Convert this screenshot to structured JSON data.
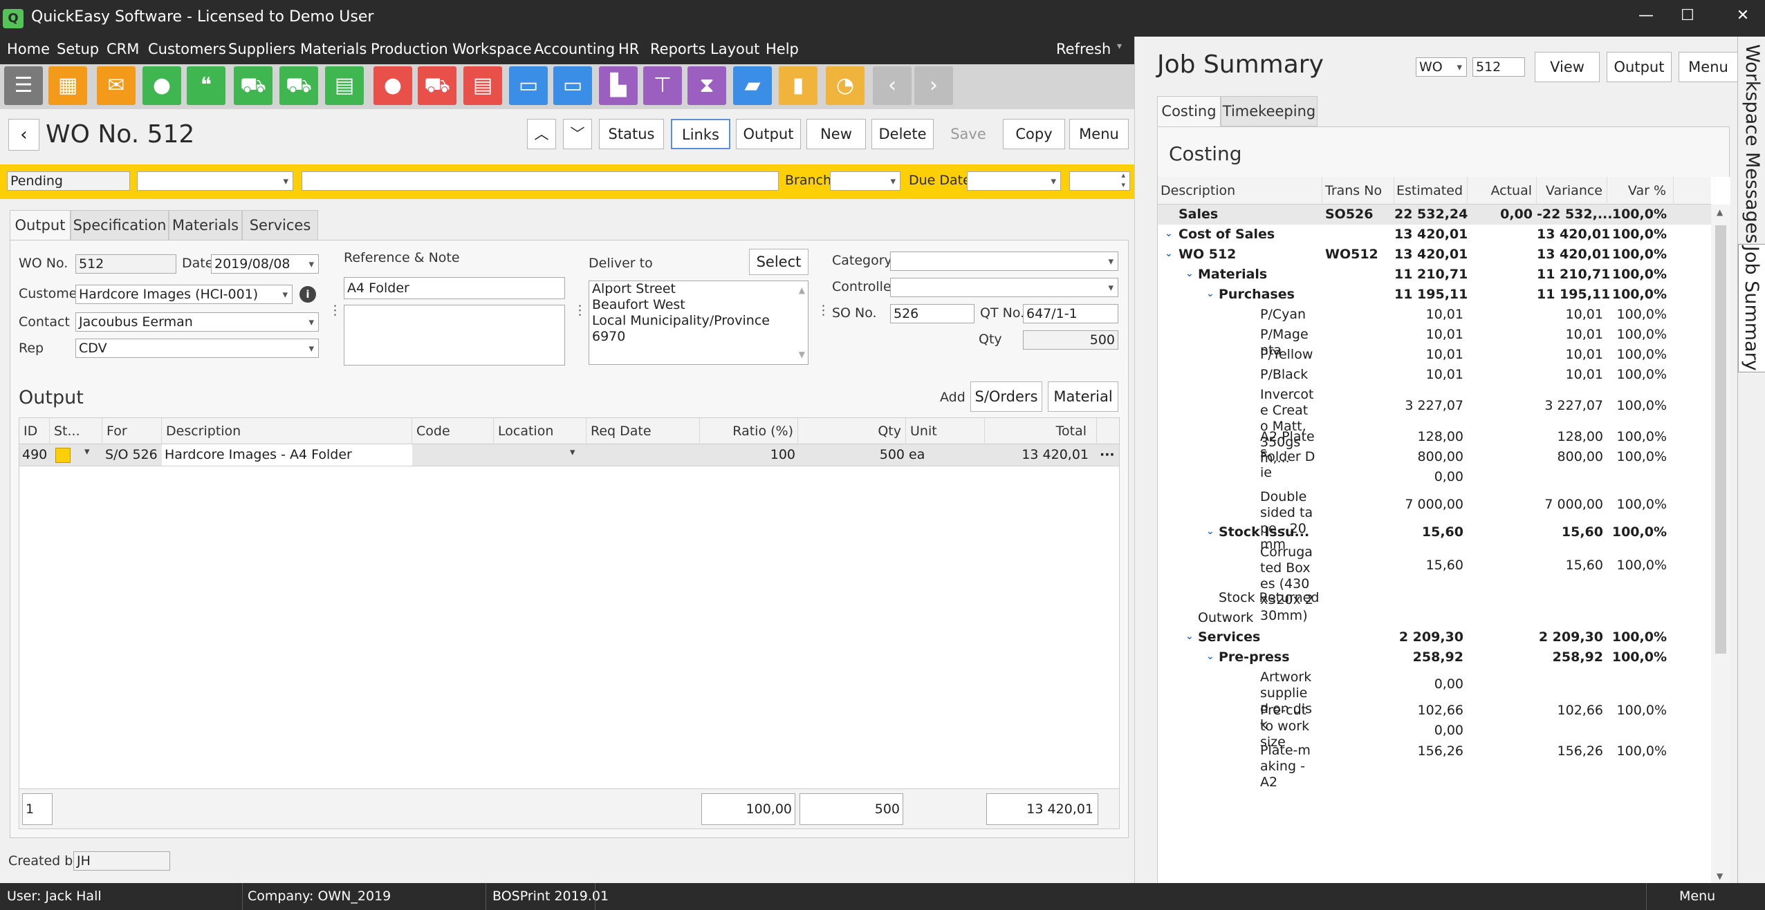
{
  "window": {
    "title": "QuickEasy Software - Licensed to Demo User",
    "logo": "Q"
  },
  "menu": {
    "items": [
      "Home",
      "Setup",
      "CRM",
      "Customers",
      "Suppliers",
      "Materials",
      "Production",
      "Workspace",
      "Accounting",
      "HR",
      "Reports",
      "Layout",
      "Help"
    ],
    "refresh_label": "Refresh"
  },
  "toolbar": {
    "icons": [
      {
        "name": "menu-icon",
        "color": "#7a7a7a",
        "glyph": "☰"
      },
      {
        "name": "calendar-check-icon",
        "color": "#f39a1b",
        "glyph": "▦"
      },
      {
        "name": "mail-icon",
        "color": "#f39a1b",
        "glyph": "✉"
      },
      {
        "name": "contact-icon",
        "color": "#3fb650",
        "glyph": "●"
      },
      {
        "name": "chat-icon",
        "color": "#3fb650",
        "glyph": "❝"
      },
      {
        "name": "cart-icon",
        "color": "#3fb650",
        "glyph": "⛟"
      },
      {
        "name": "truck-icon",
        "color": "#3fb650",
        "glyph": "⛟"
      },
      {
        "name": "document-icon",
        "color": "#3fb650",
        "glyph": "▤"
      },
      {
        "name": "customer-icon",
        "color": "#e9504a",
        "glyph": "●"
      },
      {
        "name": "purchase-cart-icon",
        "color": "#e9504a",
        "glyph": "⛟"
      },
      {
        "name": "invoice-icon",
        "color": "#e9504a",
        "glyph": "▤"
      },
      {
        "name": "payment-card-icon",
        "color": "#3a8ee6",
        "glyph": "▭"
      },
      {
        "name": "cards-icon",
        "color": "#3a8ee6",
        "glyph": "▭"
      },
      {
        "name": "factory-icon",
        "color": "#9b5fc0",
        "glyph": "▙"
      },
      {
        "name": "org-chart-icon",
        "color": "#9b5fc0",
        "glyph": "⊤"
      },
      {
        "name": "hourglass-icon",
        "color": "#9b5fc0",
        "glyph": "⧗"
      },
      {
        "name": "book-icon",
        "color": "#3a8ee6",
        "glyph": "▰"
      },
      {
        "name": "bar-chart-icon",
        "color": "#f0b43c",
        "glyph": "▮"
      },
      {
        "name": "dashboard-icon",
        "color": "#f0b43c",
        "glyph": "◔"
      },
      {
        "name": "back-arrow-icon",
        "color": "#bdbdbd",
        "glyph": "‹"
      },
      {
        "name": "forward-arrow-icon",
        "color": "#bdbdbd",
        "glyph": "›"
      }
    ]
  },
  "wo": {
    "title": "WO No. 512",
    "buttons": {
      "status": "Status",
      "links": "Links",
      "output": "Output",
      "new": "New",
      "delete": "Delete",
      "save": "Save",
      "copy": "Copy",
      "menu": "Menu"
    },
    "status": "Pending",
    "branch_label": "Branch",
    "due_date_label": "Due Date"
  },
  "tabs": [
    "Output",
    "Specification",
    "Materials",
    "Services"
  ],
  "form": {
    "wo_no_label": "WO No.",
    "wo_no": "512",
    "date_label": "Date",
    "date": "2019/08/08",
    "customer_label": "Customer",
    "customer": "Hardcore Images (HCI-001)",
    "contact_label": "Contact",
    "contact": "Jacoubus Eerman",
    "rep_label": "Rep",
    "rep": "CDV",
    "ref_label": "Reference & Note",
    "reference": "A4 Folder",
    "deliver_label": "Deliver to",
    "select_label": "Select",
    "address": [
      "Alport Street",
      "Beaufort West",
      "Local Municipality/Province",
      "6970"
    ],
    "category_label": "Category",
    "controller_label": "Controller",
    "so_label": "SO No.",
    "so": "526",
    "qt_label": "QT No.",
    "qt": "647/1-1",
    "qty_label": "Qty",
    "qty": "500"
  },
  "output": {
    "title": "Output",
    "add_label": "Add",
    "sorders_label": "S/Orders",
    "material_label": "Material",
    "columns": [
      "ID",
      "St...",
      "For",
      "Description",
      "Code",
      "Location",
      "Req Date",
      "Ratio (%)",
      "Qty",
      "Unit",
      "Total"
    ],
    "row": {
      "id": "490",
      "for": "S/O 526",
      "description": "Hardcore Images - A4 Folder",
      "ratio": "100",
      "qty": "500",
      "unit": "ea",
      "total": "13 420,01"
    },
    "footer": {
      "count": "1",
      "ratio": "100,00",
      "qty": "500",
      "total": "13 420,01"
    }
  },
  "created_by_label": "Created by",
  "created_by": "JH",
  "job_summary": {
    "title": "Job Summary",
    "type": "WO",
    "number": "512",
    "view_label": "View",
    "output_label": "Output",
    "menu_label": "Menu",
    "tabs": [
      "Costing",
      "Timekeeping"
    ],
    "costing_title": "Costing",
    "columns": [
      "Description",
      "Trans No",
      "Estimated",
      "Actual",
      "Variance",
      "Var %"
    ],
    "rows": [
      {
        "d": "Sales",
        "trans": "SO526",
        "est": "22 532,24",
        "act": "0,00",
        "var": "-22 532,...",
        "pct": "100,0%",
        "lvl": 0,
        "bold": true,
        "hl": true
      },
      {
        "d": "Cost of Sales",
        "trans": "",
        "est": "13 420,01",
        "act": "",
        "var": "13 420,01",
        "pct": "100,0%",
        "lvl": 0,
        "bold": true,
        "exp": true
      },
      {
        "d": "WO 512",
        "trans": "WO512",
        "est": "13 420,01",
        "act": "",
        "var": "13 420,01",
        "pct": "100,0%",
        "lvl": 1,
        "bold": true,
        "exp": true
      },
      {
        "d": "Materials",
        "trans": "",
        "est": "11 210,71",
        "act": "",
        "var": "11 210,71",
        "pct": "100,0%",
        "lvl": 2,
        "bold": true,
        "exp": true
      },
      {
        "d": "Purchases",
        "trans": "",
        "est": "11 195,11",
        "act": "",
        "var": "11 195,11",
        "pct": "100,0%",
        "lvl": 3,
        "bold": true,
        "exp": true
      },
      {
        "d": "P/Cyan",
        "trans": "",
        "est": "10,01",
        "act": "",
        "var": "10,01",
        "pct": "100,0%",
        "lvl": 4
      },
      {
        "d": "P/Magenta",
        "trans": "",
        "est": "10,01",
        "act": "",
        "var": "10,01",
        "pct": "100,0%",
        "lvl": 4
      },
      {
        "d": "P/Yellow",
        "trans": "",
        "est": "10,01",
        "act": "",
        "var": "10,01",
        "pct": "100,0%",
        "lvl": 4
      },
      {
        "d": "P/Black",
        "trans": "",
        "est": "10,01",
        "act": "",
        "var": "10,01",
        "pct": "100,0%",
        "lvl": 4
      },
      {
        "d": "Invercote Creato Matt, 350gsm,...",
        "trans": "",
        "est": "3 227,07",
        "act": "",
        "var": "3 227,07",
        "pct": "100,0%",
        "lvl": 4
      },
      {
        "d": "A2 Plates",
        "trans": "",
        "est": "128,00",
        "act": "",
        "var": "128,00",
        "pct": "100,0%",
        "lvl": 4
      },
      {
        "d": "Folder Die",
        "trans": "",
        "est": "800,00",
        "act": "",
        "var": "800,00",
        "pct": "100,0%",
        "lvl": 4
      },
      {
        "d": "",
        "trans": "",
        "est": "0,00",
        "act": "",
        "var": "",
        "pct": "",
        "lvl": 4
      },
      {
        "d": "Double sided tape - 20mm",
        "trans": "",
        "est": "7 000,00",
        "act": "",
        "var": "7 000,00",
        "pct": "100,0%",
        "lvl": 4
      },
      {
        "d": "Stock Issu...",
        "trans": "",
        "est": "15,60",
        "act": "",
        "var": "15,60",
        "pct": "100,0%",
        "lvl": 3,
        "bold": true,
        "exp": true
      },
      {
        "d": "Corrugated Boxes (430x320x 230mm)",
        "trans": "",
        "est": "15,60",
        "act": "",
        "var": "15,60",
        "pct": "100,0%",
        "lvl": 4
      },
      {
        "d": "Stock Returned",
        "trans": "",
        "est": "",
        "act": "",
        "var": "",
        "pct": "",
        "lvl": 3
      },
      {
        "d": "Outwork",
        "trans": "",
        "est": "",
        "act": "",
        "var": "",
        "pct": "",
        "lvl": 2
      },
      {
        "d": "Services",
        "trans": "",
        "est": "2 209,30",
        "act": "",
        "var": "2 209,30",
        "pct": "100,0%",
        "lvl": 2,
        "bold": true,
        "exp": true
      },
      {
        "d": "Pre-press",
        "trans": "",
        "est": "258,92",
        "act": "",
        "var": "258,92",
        "pct": "100,0%",
        "lvl": 3,
        "bold": true,
        "exp": true
      },
      {
        "d": "Artwork supplied on disk",
        "trans": "",
        "est": "0,00",
        "act": "",
        "var": "",
        "pct": "",
        "lvl": 4
      },
      {
        "d": "Pre-cut to work size",
        "trans": "",
        "est": "102,66",
        "act": "",
        "var": "102,66",
        "pct": "100,0%",
        "lvl": 4
      },
      {
        "d": "",
        "trans": "",
        "est": "0,00",
        "act": "",
        "var": "",
        "pct": "",
        "lvl": 4
      },
      {
        "d": "Plate-making - A2",
        "trans": "",
        "est": "156,26",
        "act": "",
        "var": "156,26",
        "pct": "100,0%",
        "lvl": 4
      }
    ]
  },
  "side_tabs": [
    "Workspace",
    "Messages",
    "Job Summary"
  ],
  "statusbar": {
    "user": "User: Jack Hall",
    "company": "Company: OWN_2019",
    "version": "BOSPrint 2019.01",
    "menu": "Menu"
  }
}
